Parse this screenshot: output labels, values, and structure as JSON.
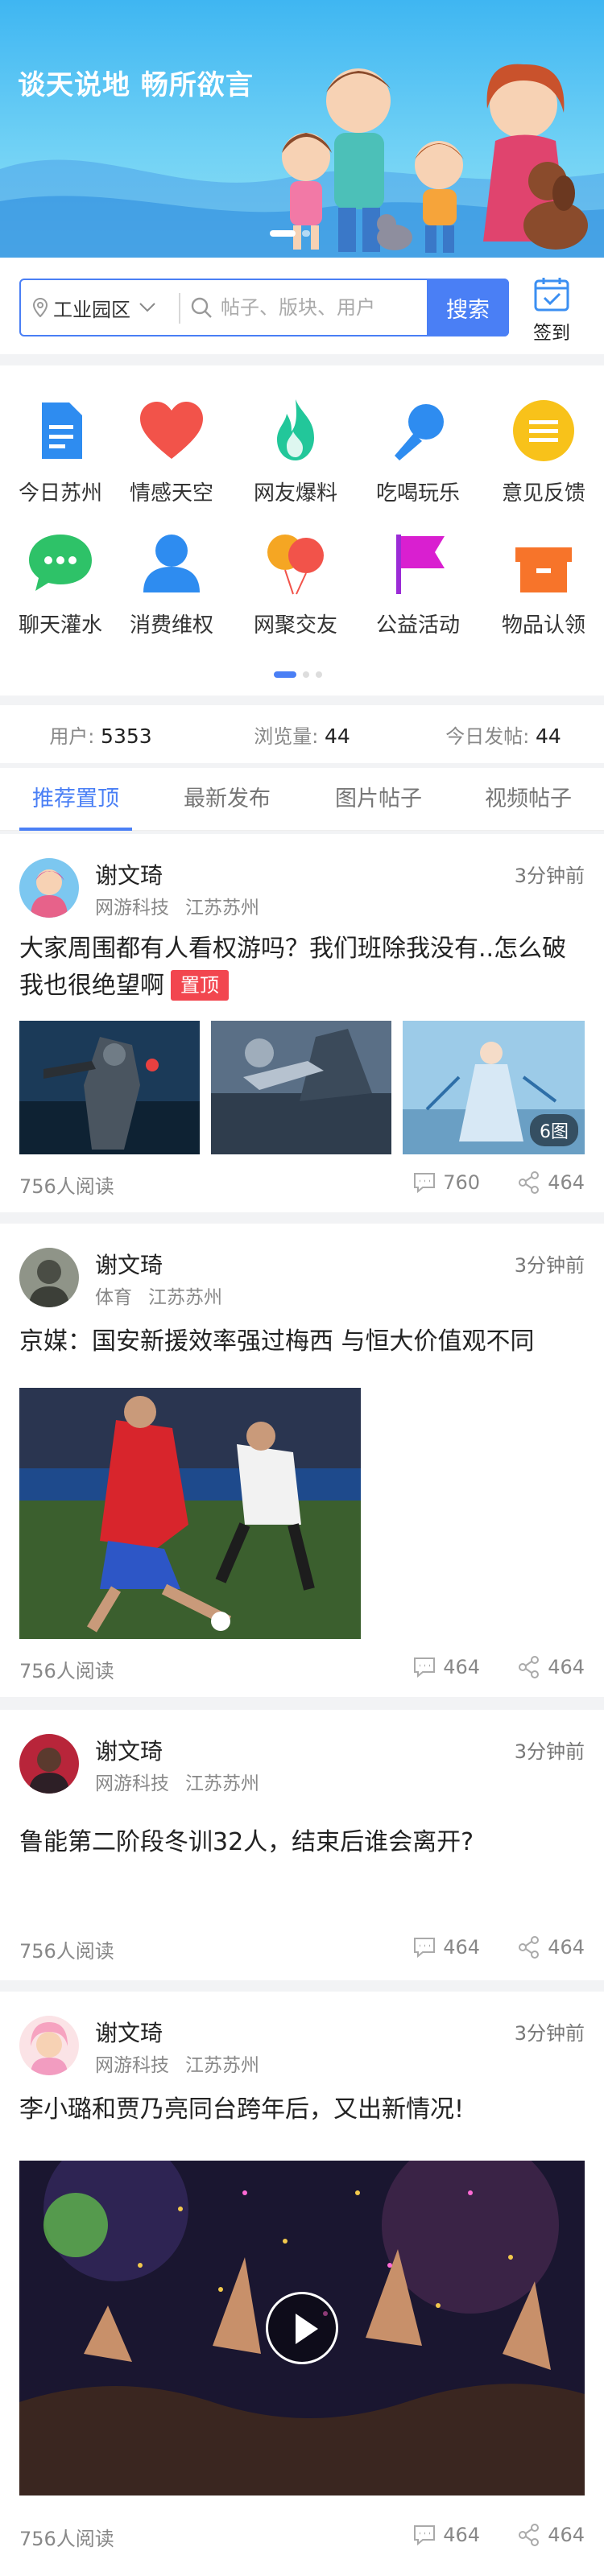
{
  "banner": {
    "slogan": "谈天说地  畅所欲言"
  },
  "search": {
    "location": "工业园区",
    "placeholder": "帖子、版块、用户",
    "button": "搜索",
    "signin_label": "签到"
  },
  "categories": [
    {
      "label": "今日苏州",
      "icon": "document-icon"
    },
    {
      "label": "情感天空",
      "icon": "heart-icon"
    },
    {
      "label": "网友爆料",
      "icon": "flame-icon"
    },
    {
      "label": "吃喝玩乐",
      "icon": "microphone-icon"
    },
    {
      "label": "意见反馈",
      "icon": "menu-icon"
    },
    {
      "label": "聊天灌水",
      "icon": "chat-bubble-icon"
    },
    {
      "label": "消费维权",
      "icon": "person-icon"
    },
    {
      "label": "网聚交友",
      "icon": "balloons-icon"
    },
    {
      "label": "公益活动",
      "icon": "flag-icon"
    },
    {
      "label": "物品认领",
      "icon": "gift-box-icon"
    }
  ],
  "stats": [
    {
      "label": "用户:",
      "value": "5353"
    },
    {
      "label": "浏览量:",
      "value": "44"
    },
    {
      "label": "今日发帖:",
      "value": "44"
    }
  ],
  "tabs": [
    "推荐置顶",
    "最新发布",
    "图片帖子",
    "视频帖子"
  ],
  "posts": [
    {
      "user": "谢文琦",
      "tag1": "网游科技",
      "tag2": "江苏苏州",
      "time": "3分钟前",
      "title": "大家周围都有人看权游吗？我们班除我没有..怎么破我也很绝望啊",
      "pin": "置顶",
      "image_count": "6图",
      "reads": "756人阅读",
      "comments": "760",
      "shares": "464"
    },
    {
      "user": "谢文琦",
      "tag1": "体育",
      "tag2": "江苏苏州",
      "time": "3分钟前",
      "title": "京媒：国安新援效率强过梅西 与恒大价值观不同",
      "reads": "756人阅读",
      "comments": "464",
      "shares": "464"
    },
    {
      "user": "谢文琦",
      "tag1": "网游科技",
      "tag2": "江苏苏州",
      "time": "3分钟前",
      "title": "鲁能第二阶段冬训32人，结束后谁会离开?",
      "reads": "756人阅读",
      "comments": "464",
      "shares": "464"
    },
    {
      "user": "谢文琦",
      "tag1": "网游科技",
      "tag2": "江苏苏州",
      "time": "3分钟前",
      "title": "李小璐和贾乃亮同台跨年后，又出新情况!",
      "reads": "756人阅读",
      "comments": "464",
      "shares": "464"
    }
  ],
  "colors": {
    "accent": "#4a7ff5",
    "pin": "#f2464f",
    "banner": "#3fb6f2"
  }
}
